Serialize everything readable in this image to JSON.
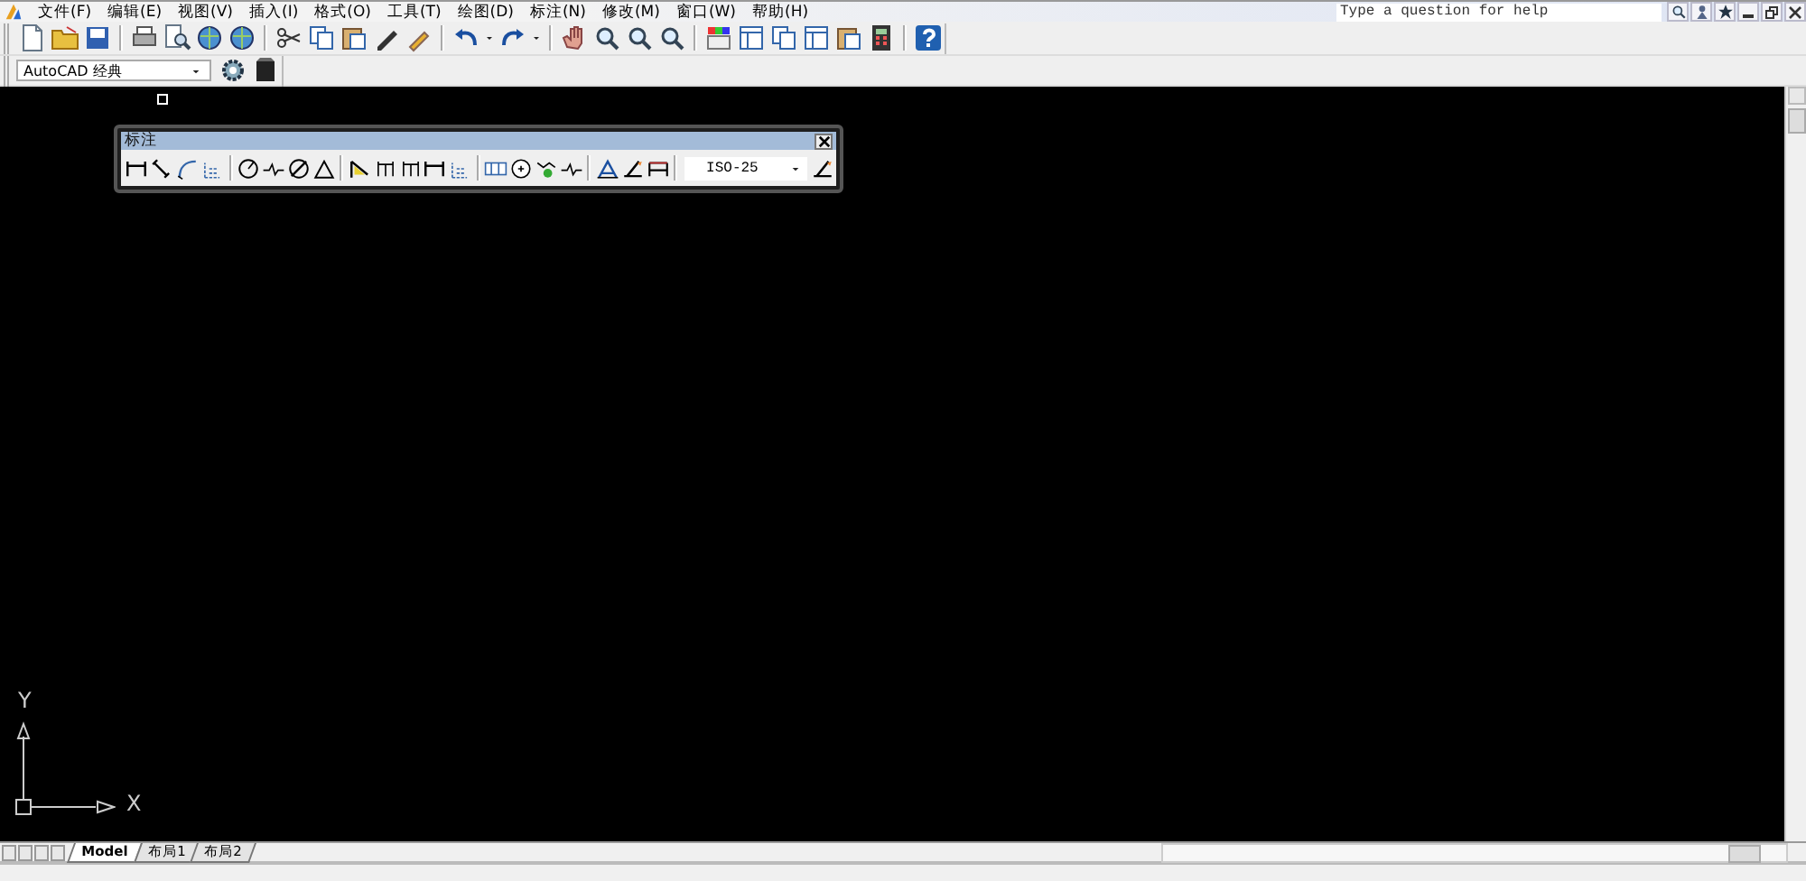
{
  "menu": [
    "文件(F)",
    "编辑(E)",
    "视图(V)",
    "插入(I)",
    "格式(O)",
    "工具(T)",
    "绘图(D)",
    "标注(N)",
    "修改(M)",
    "窗口(W)",
    "帮助(H)"
  ],
  "help_search": {
    "placeholder": "Type a question for help"
  },
  "workspace": {
    "value": "AutoCAD 经典"
  },
  "dimension_toolbar": {
    "title": "标注",
    "dim_style": "ISO-25"
  },
  "ucs": {
    "y_label": "Y",
    "x_label": "X"
  },
  "layout_tabs": [
    {
      "label": "Model",
      "selected": true
    },
    {
      "label": "布局1",
      "selected": false
    },
    {
      "label": "布局2",
      "selected": false
    }
  ]
}
